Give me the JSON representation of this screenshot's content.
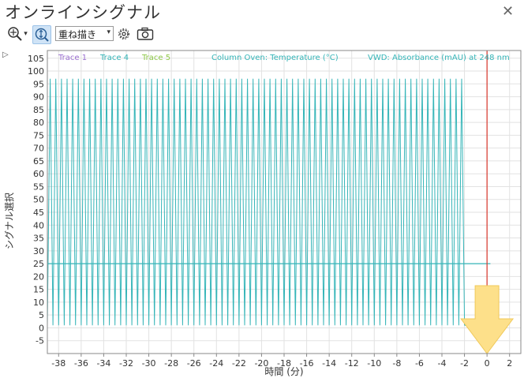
{
  "window": {
    "title": "オンラインシグナル",
    "close_glyph": "✕"
  },
  "toolbar": {
    "zoom_icon": "zoom-crosshair-icon",
    "zoom_dropdown_glyph": "▾",
    "autoscale_icon": "vertical-autoscale-icon",
    "mode_select": {
      "value": "重ね描き",
      "arrow": "▾"
    },
    "settings_icon": "gear-icon",
    "snapshot_icon": "camera-icon"
  },
  "panel": {
    "expander_glyph": "▷"
  },
  "colors": {
    "trace1": "#9b6fd0",
    "trace4": "#35b5b8",
    "trace5": "#8fc84a",
    "temperature": "#35b5b8",
    "absorbance": "#35b5b8",
    "marker": "#d9352b",
    "arrow": "#fde08a"
  },
  "chart_data": {
    "type": "line",
    "legend": [
      {
        "name": "Trace 1",
        "color": "#9b6fd0"
      },
      {
        "name": "Trace 4",
        "color": "#35b5b8"
      },
      {
        "name": "Trace 5",
        "color": "#8fc84a"
      },
      {
        "name": "Column Oven: Temperature (°C)",
        "color": "#35b5b8"
      },
      {
        "name": "VWD: Absorbance (mAU) at 248 nm",
        "color": "#35b5b8"
      }
    ],
    "xlabel": "時間 (分)",
    "ylabel": "シグナル選択",
    "xlim": [
      -39,
      3
    ],
    "ylim": [
      -10,
      108
    ],
    "xticks": [
      -38,
      -36,
      -34,
      -32,
      -30,
      -28,
      -26,
      -24,
      -22,
      -20,
      -18,
      -16,
      -14,
      -12,
      -10,
      -8,
      -6,
      -4,
      -2,
      0,
      2
    ],
    "yticks": [
      -5,
      0,
      5,
      10,
      15,
      20,
      25,
      30,
      35,
      40,
      45,
      50,
      55,
      60,
      65,
      70,
      75,
      80,
      85,
      90,
      95,
      100,
      105
    ],
    "grid": true,
    "series": [
      {
        "name": "VWD: Absorbance (mAU) at 248 nm",
        "pattern": "oscillating",
        "x_range": [
          -39,
          -2
        ],
        "low": 1,
        "high": 97,
        "period_min": 0.5
      },
      {
        "name": "Column Oven: Temperature (°C)",
        "pattern": "flat",
        "x_range": [
          -39,
          0.3
        ],
        "y": 25
      }
    ],
    "current_time_marker_x": 0,
    "now_arrow_x": 0
  }
}
